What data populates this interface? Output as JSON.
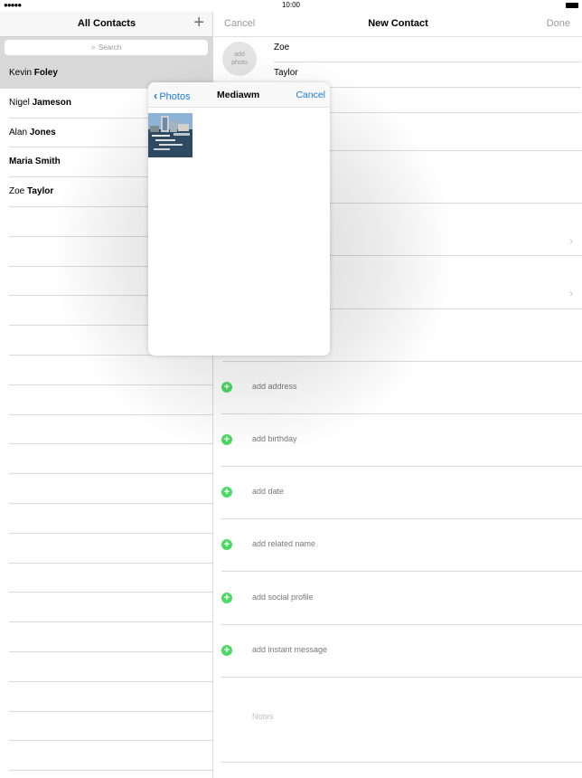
{
  "status": {
    "time": "10:00"
  },
  "left": {
    "title": "All Contacts",
    "search_placeholder": "Search",
    "contacts": [
      {
        "first": "Kevin",
        "last": "Foley",
        "selected": true
      },
      {
        "first": "Nigel",
        "last": "Jameson"
      },
      {
        "first": "Alan",
        "last": "Jones"
      },
      {
        "first": "Maria",
        "last": "Smith",
        "all_bold": true
      },
      {
        "first": "Zoe",
        "last": "Taylor"
      }
    ]
  },
  "right": {
    "cancel": "Cancel",
    "title": "New Contact",
    "done": "Done",
    "photo_line1": "add",
    "photo_line2": "photo",
    "first_name": "Zoe",
    "last_name": "Taylor",
    "add_fields": [
      "add address",
      "add birthday",
      "add date",
      "add related name",
      "add social profile",
      "add instant message"
    ],
    "notes": "Notes"
  },
  "popover": {
    "back": "Photos",
    "title": "Mediawm",
    "cancel": "Cancel"
  },
  "colors": {
    "link": "#1a7ddb",
    "add_green": "#4cd964"
  }
}
